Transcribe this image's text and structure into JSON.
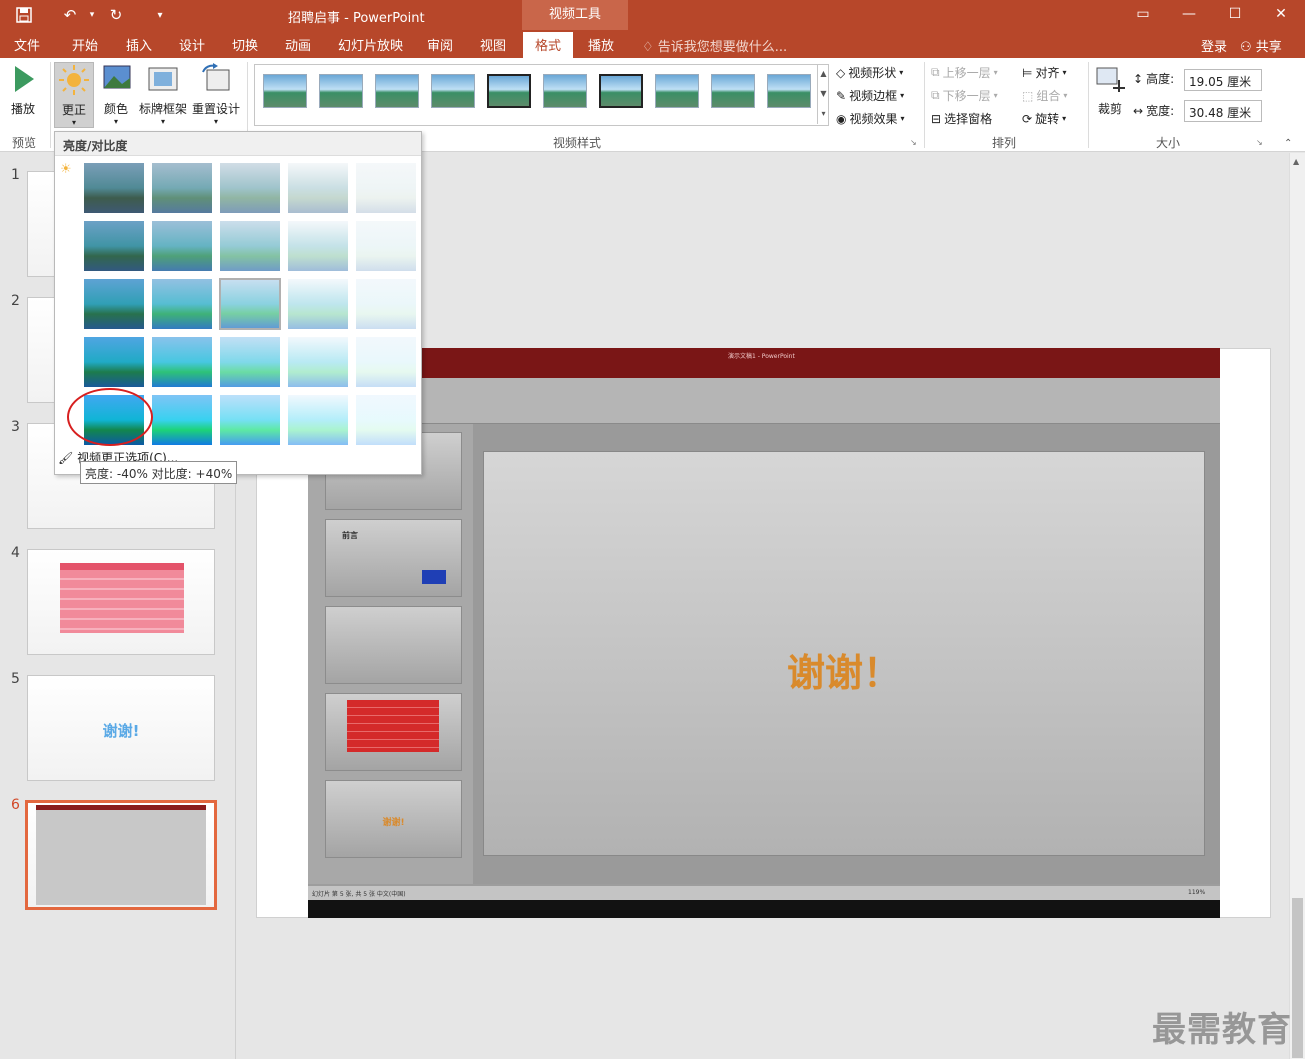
{
  "titlebar": {
    "doc_title": "招聘启事 - PowerPoint",
    "context_title": "视频工具",
    "restore_glyph": "▭",
    "minimize_glyph": "—",
    "maximize_glyph": "☐",
    "close_glyph": "✕"
  },
  "tabs": [
    "文件",
    "开始",
    "插入",
    "设计",
    "切换",
    "动画",
    "幻灯片放映",
    "审阅",
    "视图",
    "格式",
    "播放"
  ],
  "active_tab": "格式",
  "tellme": "告诉我您想要做什么...",
  "signin": "登录",
  "share": "共享",
  "ribbon": {
    "preview": {
      "play": "播放",
      "group": "预览"
    },
    "adjust": {
      "corrections": "更正",
      "color": "颜色",
      "poster_frame": "标牌框架",
      "reset_design": "重置设计"
    },
    "video_styles": {
      "group": "视频样式",
      "shape": "视频形状",
      "border": "视频边框",
      "effects": "视频效果"
    },
    "arrange": {
      "group": "排列",
      "bring_forward": "上移一层",
      "send_backward": "下移一层",
      "selection_pane": "选择窗格",
      "align": "对齐",
      "group_btn": "组合",
      "rotate": "旋转"
    },
    "size": {
      "group": "大小",
      "crop": "裁剪",
      "height_label": "高度:",
      "height_value": "19.05 厘米",
      "width_label": "宽度:",
      "width_value": "30.48 厘米"
    }
  },
  "dropdown": {
    "header": "亮度/对比度",
    "option_label": "视频更正选项(C)...",
    "tooltip": "亮度: -40% 对比度: +40%",
    "selected_cell": "row3-col3"
  },
  "slides": [
    {
      "num": "1"
    },
    {
      "num": "2"
    },
    {
      "num": "3"
    },
    {
      "num": "4"
    },
    {
      "num": "5",
      "text": "谢谢!"
    },
    {
      "num": "6"
    }
  ],
  "video": {
    "window_title": "演示文稿1 - PowerPoint",
    "thanks_text": "谢谢！",
    "thumb5_text": "谢谢!",
    "thumb2_title": "前言",
    "status_text": "幻灯片 第 5 张, 共 5 张    中文(中国)",
    "zoom_text": "119%"
  },
  "watermark": "最需教育",
  "colors": {
    "accent": "#b7472a",
    "active_thumb_border": "#e3683f",
    "video_thanks": "#d98a2c",
    "selection_circle": "#d71f1f"
  }
}
